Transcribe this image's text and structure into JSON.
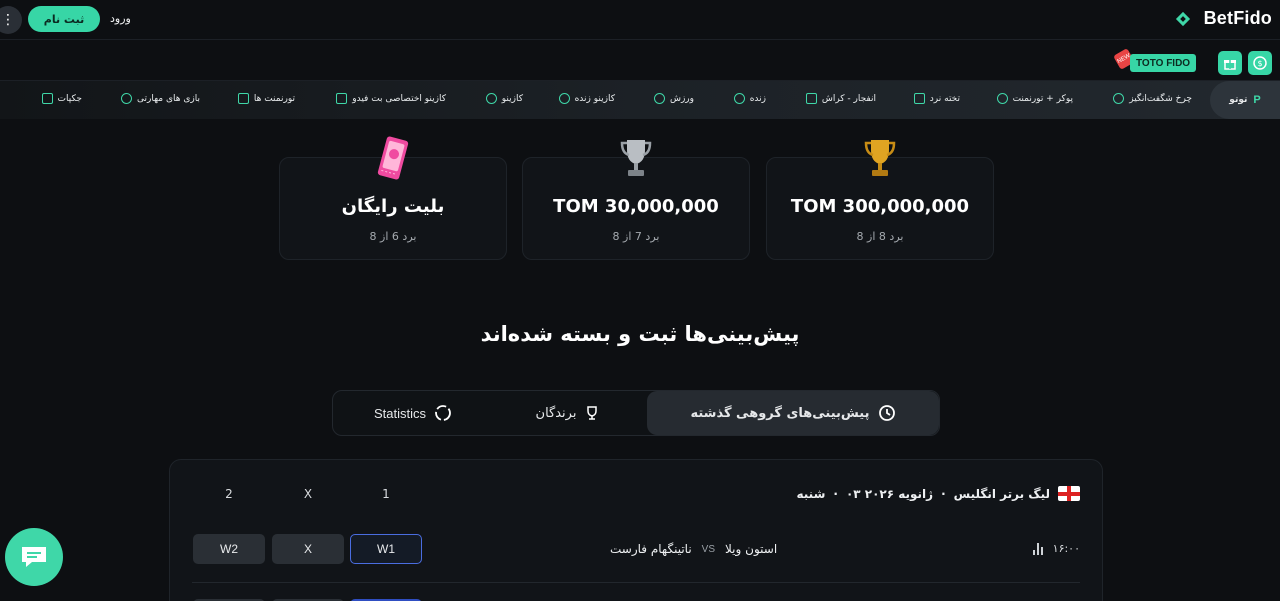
{
  "header": {
    "brand": "BetFido",
    "signup": "ثبت نام",
    "login": "ورود"
  },
  "promo": {
    "toto_label": "TOTO FIDO",
    "new_tag": "NEW"
  },
  "nav": {
    "active": "توتو",
    "items": [
      "چرخ شگفت‌انگیز",
      "پوکر + تورنمنت",
      "تخته نرد",
      "انفجار - کراش",
      "زنده",
      "ورزش",
      "کازینو زنده",
      "کازینو",
      "کازینو اختصاصی بت فیدو",
      "تورنمنت ها",
      "بازی های مهارتی",
      "جکپات"
    ]
  },
  "prizes": [
    {
      "amount": "TOM 300,000,000",
      "condition": "برد 8 از 8"
    },
    {
      "amount": "TOM 30,000,000",
      "condition": "برد 7 از 8"
    },
    {
      "amount": "بلیت رایگان",
      "condition": "برد 6 از 8"
    }
  ],
  "headline": "پیش‌بینی‌ها ثبت و بسته شده‌اند",
  "tabs": {
    "past": "پیش‌بینی‌های گروهی گذشته",
    "winners": "برندگان",
    "stats": "Statistics"
  },
  "match": {
    "league": "لیگ برتر انگلیس",
    "date": "۰۳ ژانویه ۲۰۲۶",
    "day": "شنبه",
    "time": "۱۶:۰۰",
    "home": "استون ویلا",
    "vs": "VS",
    "away": "ناتینگهام فارست",
    "columns": [
      "1",
      "X",
      "2"
    ],
    "options": [
      "W1",
      "X",
      "W2"
    ]
  },
  "colors": {
    "accent": "#37d6a6",
    "background": "#0d0f12",
    "selected_border": "#4a6de0"
  }
}
